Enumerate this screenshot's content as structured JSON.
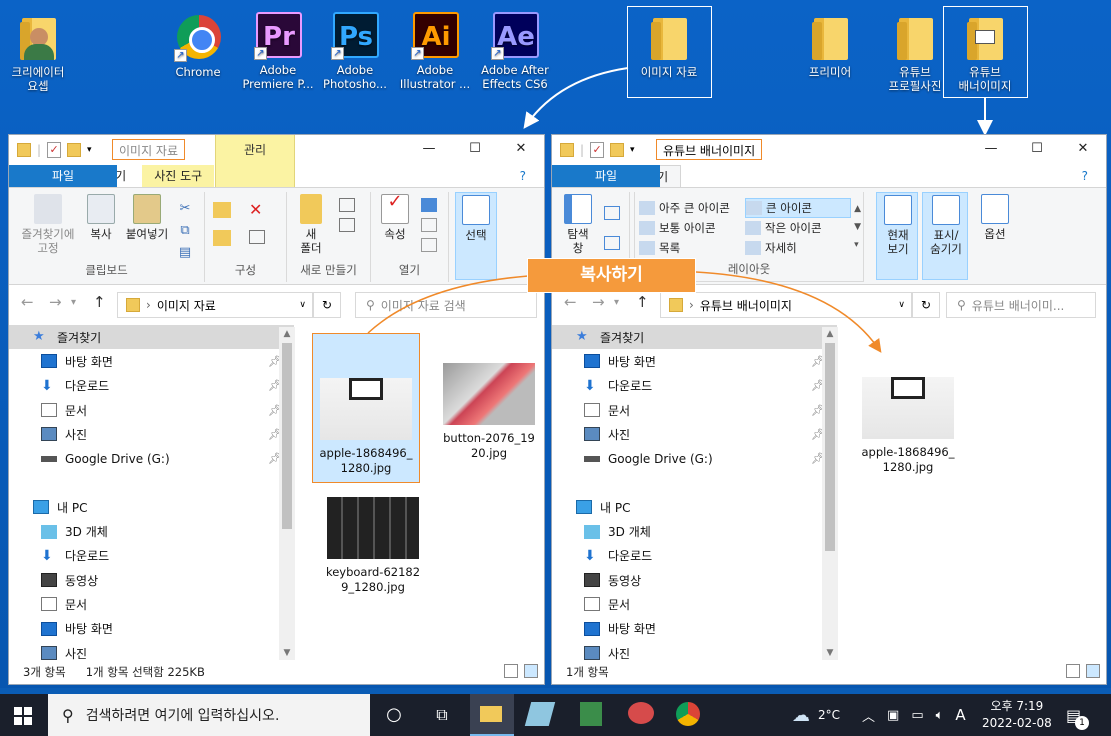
{
  "desktop": {
    "icons": [
      {
        "label": "크리에이터\n요셉",
        "icon": "user-icon"
      },
      {
        "label": "Chrome",
        "icon": "chrome-icon"
      },
      {
        "label": "Adobe\nPremiere P...",
        "icon": "premiere-icon",
        "abbr": "Pr"
      },
      {
        "label": "Adobe\nPhotosho...",
        "icon": "photoshop-icon",
        "abbr": "Ps"
      },
      {
        "label": "Adobe\nIllustrator ...",
        "icon": "illustrator-icon",
        "abbr": "Ai"
      },
      {
        "label": "Adobe After\nEffects CS6",
        "icon": "aftereffects-icon",
        "abbr": "Ae"
      },
      {
        "label": "이미지 자료",
        "icon": "folder-icon"
      },
      {
        "label": "프리미어",
        "icon": "folder-icon"
      },
      {
        "label": "유튜브\n프로필사진",
        "icon": "folder-icon"
      },
      {
        "label": "유튜브\n배너이미지",
        "icon": "folder-icon"
      }
    ]
  },
  "callout": "복사하기",
  "left_window": {
    "title": "이미지 자료",
    "context_tab": "관리",
    "tabs": [
      "파일",
      "홈",
      "공유",
      "보기",
      "사진 도구"
    ],
    "ribbon": {
      "pin_label": "즐겨찾기에\n고정",
      "copy_label": "복사",
      "paste_label": "붙여넣기",
      "group_clipboard": "클립보드",
      "group_organize": "구성",
      "new_folder_label": "새\n폴더",
      "group_new": "새로 만들기",
      "properties_label": "속성",
      "group_open": "열기",
      "select_label": "선택"
    },
    "address": "이미지 자료",
    "search_placeholder": "이미지 자료 검색",
    "nav": [
      {
        "label": "즐겨찾기",
        "icon": "star-icon",
        "pin": false,
        "selected": true
      },
      {
        "label": "바탕 화면",
        "icon": "desktop-icon",
        "pin": true
      },
      {
        "label": "다운로드",
        "icon": "download-icon",
        "pin": true
      },
      {
        "label": "문서",
        "icon": "document-icon",
        "pin": true
      },
      {
        "label": "사진",
        "icon": "pictures-icon",
        "pin": true
      },
      {
        "label": "Google Drive (G:)",
        "icon": "drive-icon",
        "pin": true
      },
      {
        "label": "",
        "icon": "",
        "pin": false
      },
      {
        "label": "내 PC",
        "icon": "pc-icon",
        "pin": false
      },
      {
        "label": "3D 개체",
        "icon": "3d-icon",
        "pin": false
      },
      {
        "label": "다운로드",
        "icon": "download-icon",
        "pin": false
      },
      {
        "label": "동영상",
        "icon": "video-icon",
        "pin": false
      },
      {
        "label": "문서",
        "icon": "document-icon",
        "pin": false
      },
      {
        "label": "바탕 화면",
        "icon": "desktop-icon",
        "pin": false
      },
      {
        "label": "사진",
        "icon": "pictures-icon",
        "pin": false
      }
    ],
    "files": [
      {
        "name": "apple-1868496_\n1280.jpg",
        "selected": true
      },
      {
        "name": "button-2076_19\n20.jpg",
        "selected": false
      },
      {
        "name": "keyboard-62182\n9_1280.jpg",
        "selected": false
      }
    ],
    "status_count": "3개 항목",
    "status_selected": "1개 항목 선택함 225KB"
  },
  "right_window": {
    "title": "유튜브 배너이미지",
    "tabs": [
      "파일",
      "홈",
      "공유",
      "보기"
    ],
    "ribbon": {
      "nav_pane": "탐색\n창",
      "layouts": [
        "아주 큰 아이콘",
        "큰 아이콘",
        "보통 아이콘",
        "작은 아이콘",
        "목록",
        "자세히"
      ],
      "group_layout": "레이아웃",
      "current_view": "현재\n보기",
      "show_hide": "표시/\n숨기기",
      "options": "옵션"
    },
    "address": "유튜브 배너이미지",
    "search_placeholder": "유튜브 배너이미...",
    "nav": [
      {
        "label": "즐겨찾기",
        "icon": "star-icon",
        "pin": false,
        "selected": true
      },
      {
        "label": "바탕 화면",
        "icon": "desktop-icon",
        "pin": true
      },
      {
        "label": "다운로드",
        "icon": "download-icon",
        "pin": true
      },
      {
        "label": "문서",
        "icon": "document-icon",
        "pin": true
      },
      {
        "label": "사진",
        "icon": "pictures-icon",
        "pin": true
      },
      {
        "label": "Google Drive (G:)",
        "icon": "drive-icon",
        "pin": true
      },
      {
        "label": "",
        "icon": "",
        "pin": false
      },
      {
        "label": "내 PC",
        "icon": "pc-icon",
        "pin": false
      },
      {
        "label": "3D 개체",
        "icon": "3d-icon",
        "pin": false
      },
      {
        "label": "다운로드",
        "icon": "download-icon",
        "pin": false
      },
      {
        "label": "동영상",
        "icon": "video-icon",
        "pin": false
      },
      {
        "label": "문서",
        "icon": "document-icon",
        "pin": false
      },
      {
        "label": "바탕 화면",
        "icon": "desktop-icon",
        "pin": false
      },
      {
        "label": "사진",
        "icon": "pictures-icon",
        "pin": false
      }
    ],
    "files": [
      {
        "name": "apple-1868496_\n1280.jpg",
        "selected": false
      }
    ],
    "status_count": "1개 항목"
  },
  "taskbar": {
    "search_placeholder": "검색하려면 여기에 입력하십시오.",
    "weather": "2°C",
    "ime": "A",
    "time": "오후 7:19",
    "date": "2022-02-08",
    "notif_count": "1"
  },
  "colors": {
    "accent": "#1979ca",
    "highlight": "#f08a2a",
    "desktop": "#0a5cb5"
  }
}
